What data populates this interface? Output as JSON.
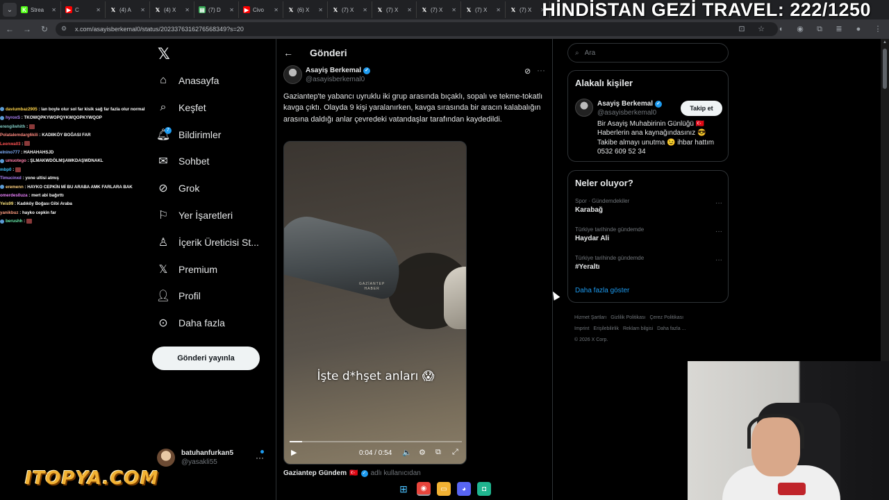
{
  "overlay": {
    "title": "HİNDİSTAN GEZİ TRAVEL: 222/1250",
    "brand": "ITOPYA.COM"
  },
  "browser": {
    "tabs": [
      {
        "label": "Strea",
        "icon": "kick-icon",
        "color": "#53fc18"
      },
      {
        "label": "C",
        "icon": "youtube-icon",
        "color": "#ff0000"
      },
      {
        "label": "(4) A",
        "icon": "x-icon",
        "color": "#000000"
      },
      {
        "label": "(4) X",
        "icon": "x-icon",
        "color": "#000000"
      },
      {
        "label": "(7) D",
        "icon": "doc-icon",
        "color": "#34a853"
      },
      {
        "label": "Civo",
        "icon": "youtube-icon",
        "color": "#ff0000"
      },
      {
        "label": "(6) X",
        "icon": "x-icon",
        "color": "#000000"
      },
      {
        "label": "(7) X",
        "icon": "x-icon",
        "color": "#000000"
      },
      {
        "label": "(7) X",
        "icon": "x-icon",
        "color": "#000000"
      },
      {
        "label": "(7) X",
        "icon": "x-icon",
        "color": "#000000"
      },
      {
        "label": "(7) X",
        "icon": "x-icon",
        "color": "#000000"
      },
      {
        "label": "(7) X",
        "icon": "x-icon",
        "color": "#000000"
      }
    ],
    "url": "x.com/asayisberkemal0/status/2023376316276568349?s=20"
  },
  "chat": [
    {
      "user": "daviumbaz2905",
      "color": "#ffd54a",
      "msg": "lan boyle olur sol far kisik sağ far fazla olur normal",
      "badge": true
    },
    {
      "user": "hyroxS",
      "color": "#b388ff",
      "msg": "TKOWQPKYWOPQYKWQOPKYWQOP",
      "badge": true
    },
    {
      "user": "erengilwhith",
      "color": "#80cbc4",
      "msg": "",
      "emote": true
    },
    {
      "user": "Polatalemdarg6kili",
      "color": "#ff8a80",
      "msg": "KADIIKÖY BOĞASI FAR"
    },
    {
      "user": "Leenwa03",
      "color": "#ff5252",
      "msg": "",
      "emote": true
    },
    {
      "user": "elnino777",
      "color": "#82b1ff",
      "msg": "HAHAHAHSJD"
    },
    {
      "user": "umuotego",
      "color": "#ff80ab",
      "msg": "ŞLMAKWDÖLMŞAWKDAŞWDNAKL",
      "badge": true
    },
    {
      "user": "mbp0",
      "color": "#40c4ff",
      "msg": "",
      "emote": true
    },
    {
      "user": "Timucinxd",
      "color": "#b388ff",
      "msg": "yone ultisi atmış"
    },
    {
      "user": "eremenn",
      "color": "#ffd180",
      "msg": "HAYKO CEPKİN Mİ BU ARABA AMK FARLARA BAK",
      "badge": true
    },
    {
      "user": "omerdes0uza",
      "color": "#ea80fc",
      "msg": "mert abi bağırttı"
    },
    {
      "user": "Yeis99",
      "color": "#ffe57f",
      "msg": "Kadıköy Boğası Gibi Araba"
    },
    {
      "user": "yanikbuz",
      "color": "#ff9e80",
      "msg": "hayko cepkin far"
    },
    {
      "user": "berushh",
      "color": "#69f0ae",
      "msg": "",
      "badge": true,
      "emote": true
    }
  ],
  "sidebar": {
    "items": [
      {
        "label": "Anasayfa",
        "icon": "home-icon"
      },
      {
        "label": "Keşfet",
        "icon": "search-icon"
      },
      {
        "label": "Bildirimler",
        "icon": "bell-icon",
        "badge": "7"
      },
      {
        "label": "Sohbet",
        "icon": "mail-icon"
      },
      {
        "label": "Grok",
        "icon": "grok-icon"
      },
      {
        "label": "Yer İşaretleri",
        "icon": "bookmark-icon"
      },
      {
        "label": "İçerik Üreticisi St...",
        "icon": "creator-studio-icon"
      },
      {
        "label": "Premium",
        "icon": "x-premium-icon"
      },
      {
        "label": "Profil",
        "icon": "profile-icon"
      },
      {
        "label": "Daha fazla",
        "icon": "more-circle-icon"
      }
    ],
    "post_button": "Gönderi yayınla",
    "account": {
      "name": "batuhanfurkan5",
      "handle": "@yasakli55"
    }
  },
  "main": {
    "title": "Gönderi",
    "tweet": {
      "author": "Asayiş Berkemal",
      "handle": "@asayisberkemal0",
      "text": "Gaziantep'te yabancı uyruklu iki grup arasında bıçaklı, sopalı ve tekme-tokatlı kavga çıktı. Olayda 9 kişi yaralanırken, kavga sırasında bir aracın kalabalığın arasına daldığı anlar çevredeki vatandaşlar tarafından kaydedildi.",
      "video": {
        "caption": "İşte d*hşet anları 😱",
        "watermark_1": "GAZİANTEP",
        "watermark_2": "HABER",
        "time": "0:04 / 0:54",
        "progress": 0.074
      },
      "quoted_source": "Gaziantep Gündem",
      "quoted_flag": "🇹🇷",
      "quoted_note": "adlı kullanıcıdan"
    }
  },
  "right": {
    "search_placeholder": "Ara",
    "related": {
      "title": "Alakalı kişiler",
      "name": "Asayiş Berkemal",
      "handle": "@asayisberkemal0",
      "follow": "Takip et",
      "bio": "Bir Asayiş Muhabirinin Günlüğü 🇹🇷 Haberlerin ana kaynağındasınız 😎 Takibe almayı unutma 😉 ihbar hattım 0532 609 52 34"
    },
    "trends": {
      "title": "Neler oluyor?",
      "items": [
        {
          "category": "Spor · Gündemdekiler",
          "name": "Karabağ"
        },
        {
          "category": "Türkiye tarihinde gündemde",
          "name": "Haydar Ali"
        },
        {
          "category": "Türkiye tarihinde gündemde",
          "name": "#Yeraltı"
        }
      ],
      "show_more": "Daha fazla göster"
    },
    "footer": [
      "Hizmet Şartları",
      "Gizlilik Politikası",
      "Çerez Politikası",
      "Imprint",
      "Erişilebilirlik",
      "Reklam bilgisi",
      "Daha fazla ...",
      "© 2026 X Corp."
    ]
  },
  "colors": {
    "accent": "#1d9bf0",
    "background": "#000000",
    "border": "#2f3336",
    "text": "#e7e9ea",
    "muted": "#71767b"
  }
}
